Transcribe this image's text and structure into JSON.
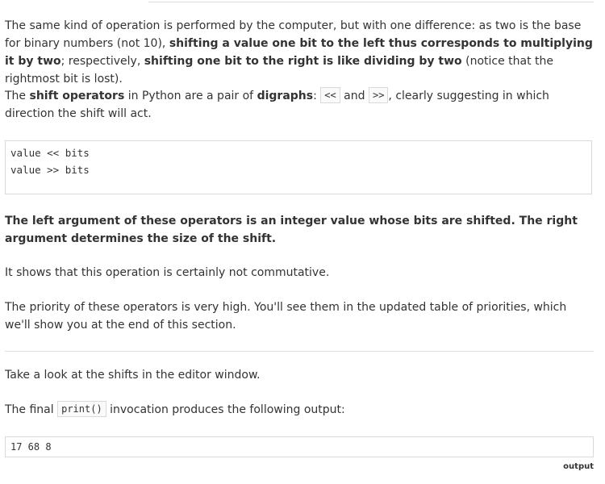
{
  "para1": {
    "t1": "The same kind of operation is performed by the computer, but with one difference: as two is the base for binary numbers (not 10), ",
    "b1": "shifting a value one bit to the left thus corresponds to multiplying it by two",
    "t2": "; respectively, ",
    "b2": "shifting one bit to the right is like dividing by two",
    "t3": " (notice that the rightmost bit is lost)."
  },
  "para2": {
    "t1": "The ",
    "b1": "shift operators",
    "t2": " in Python are a pair of ",
    "b2": "digraphs",
    "t3": ": ",
    "code1": "<<",
    "t4": " and ",
    "code2": ">>",
    "t5": ", clearly suggesting in which direction the shift will act."
  },
  "code_block": {
    "line1": "value << bits",
    "line2": "value >> bits"
  },
  "para3": "The left argument of these operators is an integer value whose bits are shifted. The right argument determines the size of the shift.",
  "para4": "It shows that this operation is certainly not commutative.",
  "para5": "The priority of these operators is very high. You'll see them in the updated table of priorities, which we'll show you at the end of this section.",
  "para6": "Take a look at the shifts in the editor window.",
  "para7": {
    "t1": "The final ",
    "code": "print()",
    "t2": " invocation produces the following output:"
  },
  "output": {
    "value": "17 68 8",
    "label": "output"
  }
}
